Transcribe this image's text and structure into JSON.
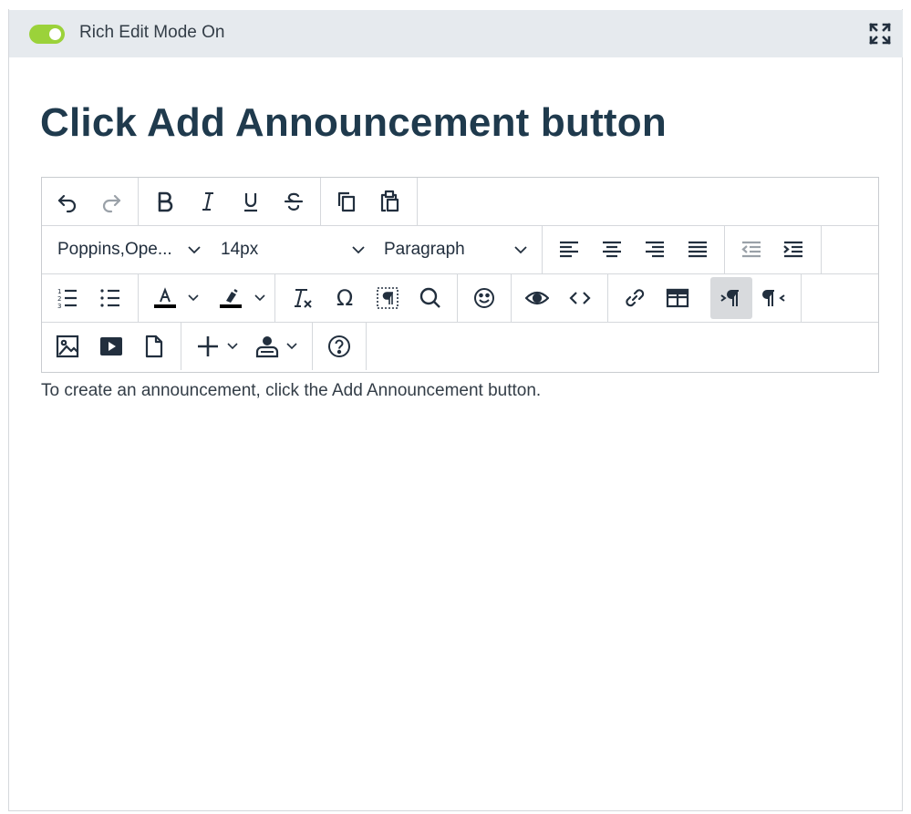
{
  "mode_toggle": {
    "label": "Rich Edit Mode On",
    "state": "on",
    "color": "#9bd23a"
  },
  "page": {
    "heading": "Click Add Announcement button"
  },
  "toolbar": {
    "font_family": "Poppins,Ope...",
    "font_size": "14px",
    "block_format": "Paragraph"
  },
  "editor": {
    "body": "To create an announcement, click the Add Announcement button."
  }
}
